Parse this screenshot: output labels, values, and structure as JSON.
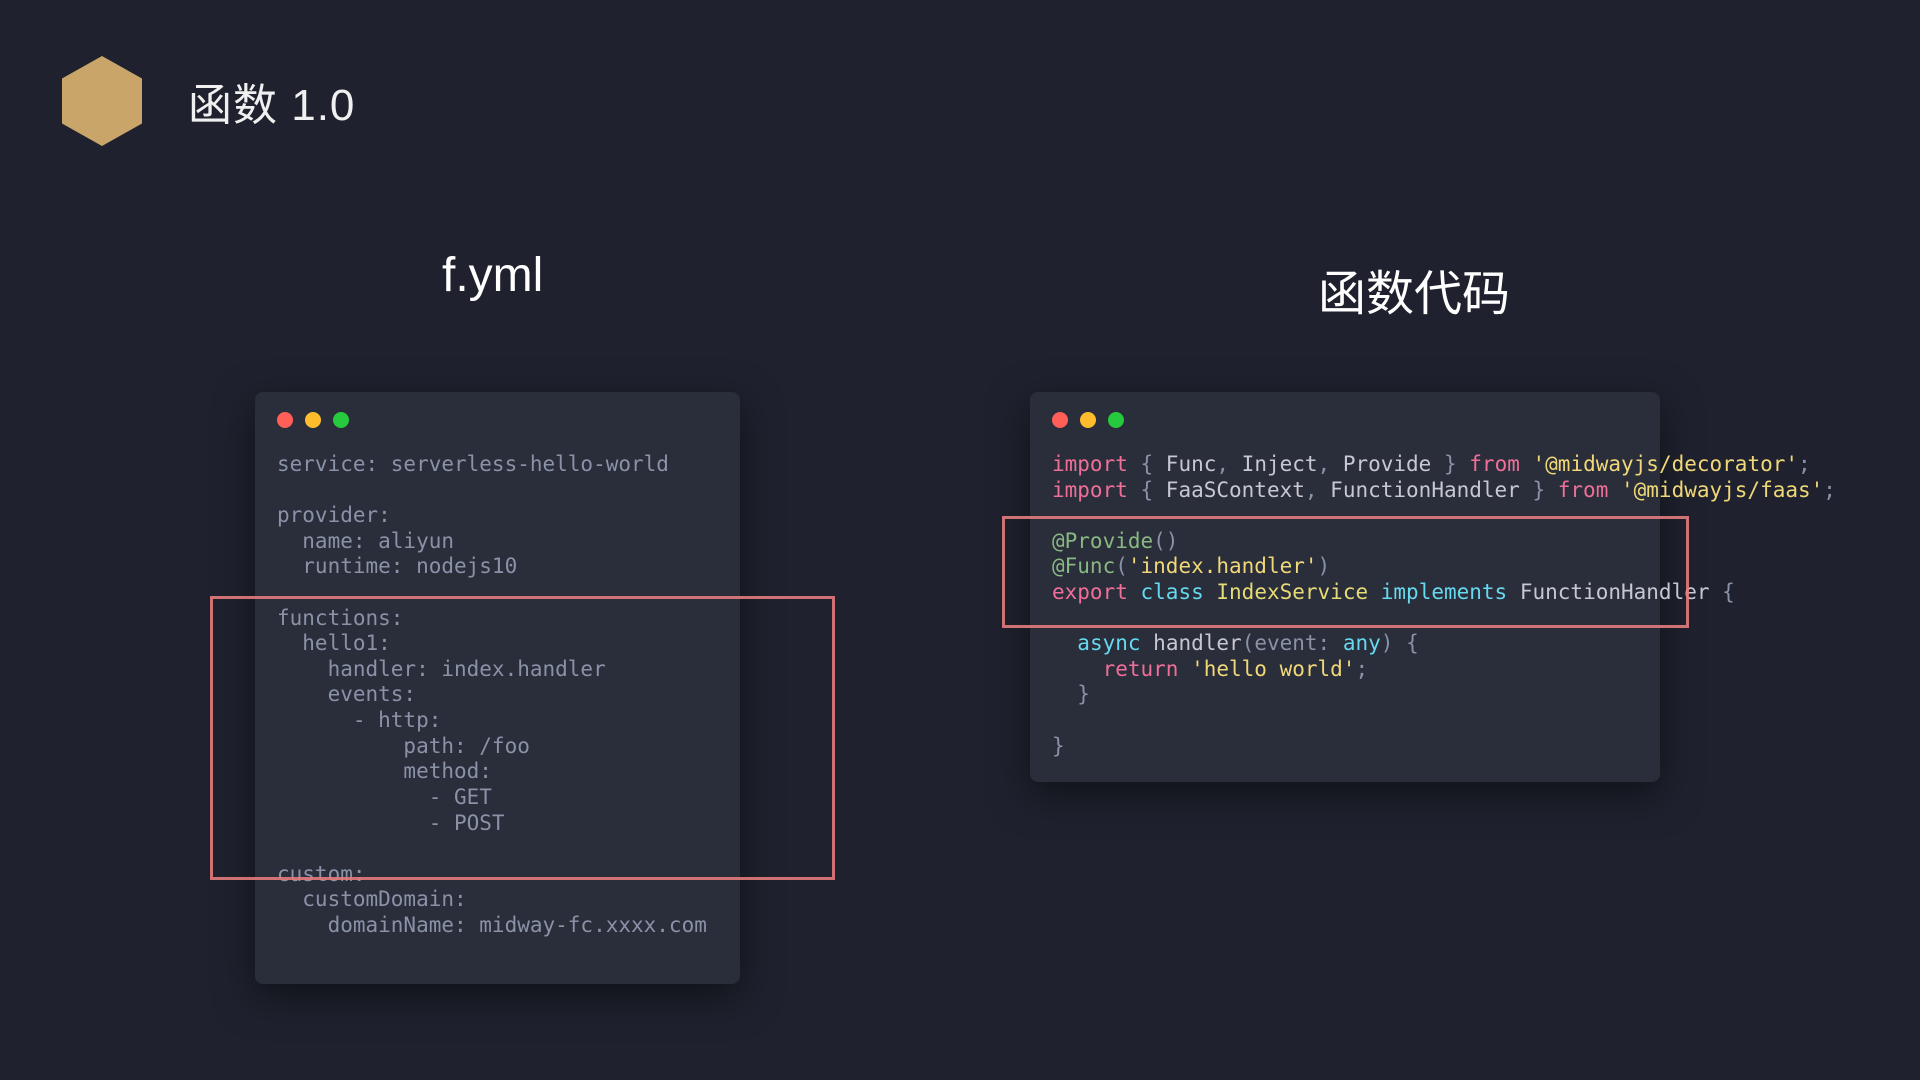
{
  "header": {
    "title": "函数 1.0"
  },
  "columns": {
    "left_title": "f.yml",
    "right_title": "函数代码"
  },
  "yml_code": "service: serverless-hello-world\n\nprovider:\n  name: aliyun\n  runtime: nodejs10\n\nfunctions:\n  hello1:\n    handler: index.handler\n    events:\n      - http:\n          path: /foo\n          method:\n            - GET\n            - POST\n\ncustom:\n  customDomain:\n    domainName: midway-fc.xxxx.com"
}
